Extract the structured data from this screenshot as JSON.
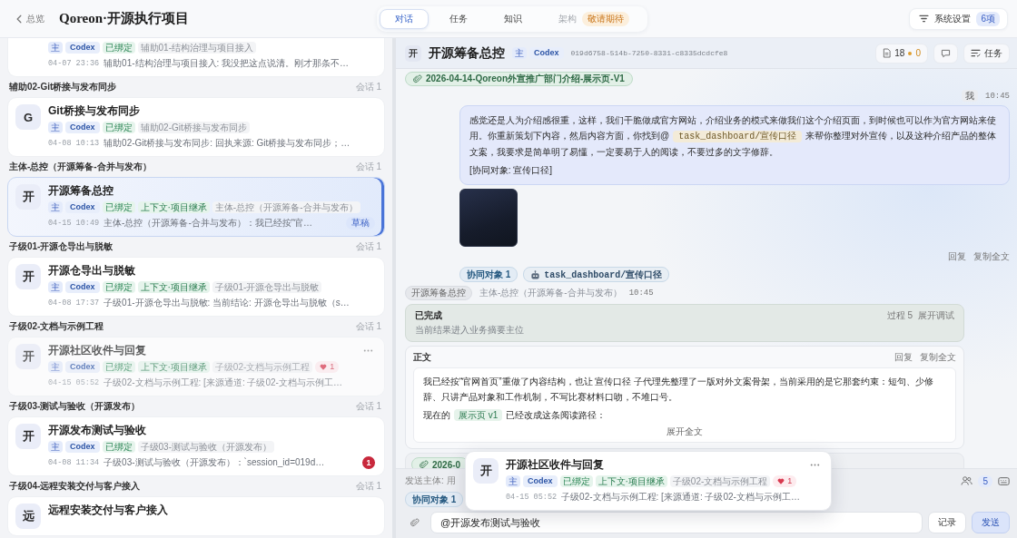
{
  "topbar": {
    "back_label": "总览",
    "title": "Qoreon·开源执行项目",
    "tabs": [
      {
        "label": "对话",
        "selected": true,
        "disabled": false
      },
      {
        "label": "任务",
        "selected": false,
        "disabled": false
      },
      {
        "label": "知识",
        "selected": false,
        "disabled": false
      },
      {
        "label": "架构",
        "selected": false,
        "disabled": true,
        "badge": "敬请期待"
      }
    ],
    "settings": {
      "label": "系统设置",
      "badge": "6项"
    }
  },
  "sidebar": {
    "groups": [
      {
        "sessions": [
          {
            "tags": [
              {
                "label": "主",
                "kind": "role"
              },
              {
                "label": "Codex",
                "kind": "agent"
              },
              {
                "label": "已绑定",
                "kind": "bound"
              },
              {
                "label": "辅助01-结构治理与项目接入",
                "kind": "scope"
              }
            ],
            "time": "04-07 23:36",
            "preview": "辅助01-结构治理与项目接入: 我没把这点说清。刚才那条不…",
            "selected": false,
            "dragging": false
          }
        ]
      },
      {
        "title": "辅助02-Git桥接与发布同步",
        "count": "会话 1",
        "sessions": [
          {
            "avatar": "G",
            "title": "Git桥接与发布同步",
            "tags": [
              {
                "label": "主",
                "kind": "role"
              },
              {
                "label": "Codex",
                "kind": "agent"
              },
              {
                "label": "已绑定",
                "kind": "bound"
              },
              {
                "label": "辅助02-Git桥接与发布同步",
                "kind": "scope"
              }
            ],
            "time": "04-08 10:13",
            "preview": "辅助02-Git桥接与发布同步: 回执来源: Git桥接与发布同步；…",
            "selected": false,
            "dragging": false,
            "menu_visible": false
          }
        ]
      },
      {
        "title": "主体-总控（开源筹备-合并与发布）",
        "count": "会话 1",
        "sessions": [
          {
            "avatar": "开",
            "title": "开源筹备总控",
            "tags": [
              {
                "label": "主",
                "kind": "role"
              },
              {
                "label": "Codex",
                "kind": "agent"
              },
              {
                "label": "已绑定",
                "kind": "bound"
              },
              {
                "label": "上下文·项目继承",
                "kind": "context"
              },
              {
                "label": "主体-总控（开源筹备-合并与发布）",
                "kind": "scope"
              }
            ],
            "time": "04-15 10:49",
            "preview": "主体-总控（开源筹备-合并与发布）：我已经按“官…",
            "badge": {
              "label": "草稿",
              "kind": "draft"
            },
            "selected": true,
            "dragging": false,
            "menu_visible": false
          }
        ]
      },
      {
        "title": "子级01-开源仓导出与脱敏",
        "count": "会话 1",
        "sessions": [
          {
            "avatar": "开",
            "title": "开源仓导出与脱敏",
            "tags": [
              {
                "label": "主",
                "kind": "role"
              },
              {
                "label": "Codex",
                "kind": "agent"
              },
              {
                "label": "已绑定",
                "kind": "bound"
              },
              {
                "label": "上下文·项目继承",
                "kind": "context"
              },
              {
                "label": "子级01-开源仓导出与脱敏",
                "kind": "scope"
              }
            ],
            "time": "04-08 17:37",
            "preview": "子级01-开源仓导出与脱敏: 当前结论: 开源仓导出与脱敏（s…",
            "selected": false,
            "dragging": false,
            "menu_visible": false
          }
        ]
      },
      {
        "title": "子级02-文档与示例工程",
        "count": "会话 1",
        "sessions": [
          {
            "avatar": "开",
            "title": "开源社区收件与回复",
            "tags": [
              {
                "label": "主",
                "kind": "role"
              },
              {
                "label": "Codex",
                "kind": "agent"
              },
              {
                "label": "已绑定",
                "kind": "bound"
              },
              {
                "label": "上下文·项目继承",
                "kind": "context"
              },
              {
                "label": "子级02-文档与示例工程",
                "kind": "scope"
              },
              {
                "label": "1",
                "kind": "likes"
              }
            ],
            "time": "04-15 05:52",
            "preview": "子级02-文档与示例工程: [来源通道: 子级02-文档与示例工…",
            "selected": false,
            "dragging": true,
            "menu_visible": true
          }
        ]
      },
      {
        "title": "子级03-测试与验收（开源发布）",
        "count": "会话 1",
        "sessions": [
          {
            "avatar": "开",
            "title": "开源发布测试与验收",
            "tags": [
              {
                "label": "主",
                "kind": "role"
              },
              {
                "label": "Codex",
                "kind": "agent"
              },
              {
                "label": "已绑定",
                "kind": "bound"
              },
              {
                "label": "子级03-测试与验收（开源发布）",
                "kind": "scope"
              }
            ],
            "time": "04-08 11:34",
            "preview": "子级03-测试与验收（开源发布）：`session_id=019d…",
            "badge": {
              "label": "1",
              "kind": "unread"
            },
            "selected": false,
            "dragging": false,
            "menu_visible": false
          }
        ]
      },
      {
        "title": "子级04-远程安装交付与客户接入",
        "count": "会话 1",
        "sessions": [
          {
            "avatar": "远",
            "title": "远程安装交付与客户接入",
            "selected": false,
            "dragging": false,
            "menu_visible": false
          }
        ]
      }
    ]
  },
  "conversation": {
    "header": {
      "avatar": "开",
      "title": "开源筹备总控",
      "tags": [
        {
          "label": "主",
          "kind": "role"
        },
        {
          "label": "Codex",
          "kind": "agent"
        }
      ],
      "session_id": "019d6758-514b-7250-8331-c8335dcdcfe8",
      "files": "18",
      "warnings": "0",
      "tasks_label": "任务"
    },
    "messages": [
      {
        "kind": "attachment",
        "label": "2026-04-14-Qoreon外宣推广部门介绍-展示页-V1",
        "framed": false
      },
      {
        "kind": "user",
        "sender": "我",
        "time": "10:45",
        "paragraphs": [
          [
            {
              "kind": "text",
              "text": "感觉还是人为介绍感很重，这样，我们干脆做成官方网站，介绍业务的模式来做我们这个介绍页面，到时候也可以作为官方网站来使用。你重新策划下内容，然后内容方面，你找到@"
            },
            {
              "kind": "mention",
              "text": "task_dashboard/宣传口径"
            },
            {
              "kind": "text",
              "text": "来帮你整理对外宣传，以及这种介绍产品的整体文案，我要求是简单明了易懂，一定要易于人的阅读，不要过多的文字修辞。"
            }
          ],
          [
            {
              "kind": "text",
              "text": "[协同对象: 宣传口径]"
            }
          ]
        ],
        "image": true,
        "actions": [
          "回复",
          "复制全文"
        ],
        "chips": [
          {
            "label": "协同对象 1",
            "kind": "count"
          },
          {
            "label": "task_dashboard/宣传口径",
            "kind": "agent"
          }
        ]
      },
      {
        "kind": "agent",
        "sender": "开源筹备总控",
        "scope": "主体-总控（开源筹备-合并与发布）",
        "time": "10:45",
        "status": {
          "title": "已完成",
          "subtitle": "当前结果进入业务摘要主位",
          "process": "过程 5",
          "action": "展开调试"
        },
        "body": {
          "label": "正文",
          "actions": [
            "回复",
            "复制全文"
          ],
          "paragraphs": [
            [
              {
                "kind": "text",
                "text": "我已经按“官网首页”重做了内容结构，也让 宣传口径 子代理先整理了一版对外文案骨架，当前采用的是它那套约束：短句、少修辞、只讲产品对象和工作机制，不写比赛材料口吻，不堆口号。"
              }
            ],
            [
              {
                "kind": "text",
                "text": "现在的"
              },
              {
                "kind": "page",
                "text": "展示页 v1"
              },
              {
                "kind": "text",
                "text": "已经改成这条阅读路径："
              }
            ]
          ],
          "more": "展开全文"
        }
      },
      {
        "kind": "attachment",
        "label": "2026-0",
        "framed": true
      }
    ]
  },
  "composer": {
    "sender_hint": "发送主体: 用",
    "participants": "5",
    "chips": [
      {
        "label": "协同对象 1",
        "kind": "count"
      }
    ],
    "input_value": "@开源发布测试与验收",
    "buttons": [
      {
        "label": "记录",
        "primary": false
      },
      {
        "label": "发送",
        "primary": true
      }
    ]
  },
  "drag_preview": {
    "avatar": "开",
    "title": "开源社区收件与回复",
    "tags": [
      {
        "label": "主",
        "kind": "role"
      },
      {
        "label": "Codex",
        "kind": "agent"
      },
      {
        "label": "已绑定",
        "kind": "bound"
      },
      {
        "label": "上下文·项目继承",
        "kind": "context"
      },
      {
        "label": "子级02-文档与示例工程",
        "kind": "scope"
      },
      {
        "label": "1",
        "kind": "likes"
      }
    ],
    "time": "04-15 05:52",
    "preview": "子级02-文档与示例工程: [来源通道: 子级02-文档与示例工…",
    "selected": false,
    "dragging": false,
    "menu_visible": true
  }
}
